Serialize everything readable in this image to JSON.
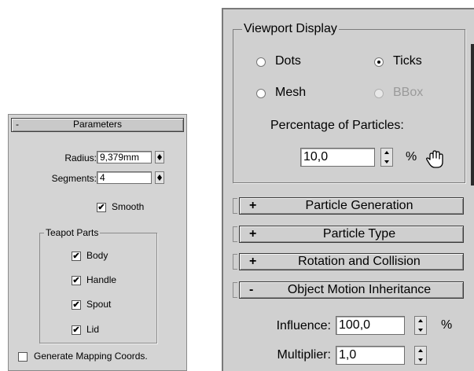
{
  "left": {
    "rollout_sign": "-",
    "rollout_title": "Parameters",
    "radius_label": "Radius:",
    "radius_value": "9,379mm",
    "segments_label": "Segments:",
    "segments_value": "4",
    "smooth_label": "Smooth",
    "smooth_checked": "✔",
    "group_title": "Teapot Parts",
    "parts": [
      {
        "label": "Body",
        "check": "✔"
      },
      {
        "label": "Handle",
        "check": "✔"
      },
      {
        "label": "Spout",
        "check": "✔"
      },
      {
        "label": "Lid",
        "check": "✔"
      }
    ],
    "mapping_label": "Generate Mapping Coords."
  },
  "right": {
    "viewport_group_title": "Viewport Display",
    "radio_dots": "Dots",
    "radio_ticks": "Ticks",
    "radio_mesh": "Mesh",
    "radio_bbox": "BBox",
    "percentage_label": "Percentage of Particles:",
    "percentage_value": "10,0",
    "percentage_unit": "%",
    "rollouts": [
      {
        "sign": "+",
        "title": "Particle Generation"
      },
      {
        "sign": "+",
        "title": "Particle Type"
      },
      {
        "sign": "+",
        "title": "Rotation and Collision"
      },
      {
        "sign": "-",
        "title": "Object Motion Inheritance"
      }
    ],
    "influence_label": "Influence:",
    "influence_value": "100,0",
    "influence_unit": "%",
    "multiplier_label": "Multiplier:",
    "multiplier_value": "1,0"
  },
  "icons": {
    "hand": "pan-hand-icon"
  }
}
